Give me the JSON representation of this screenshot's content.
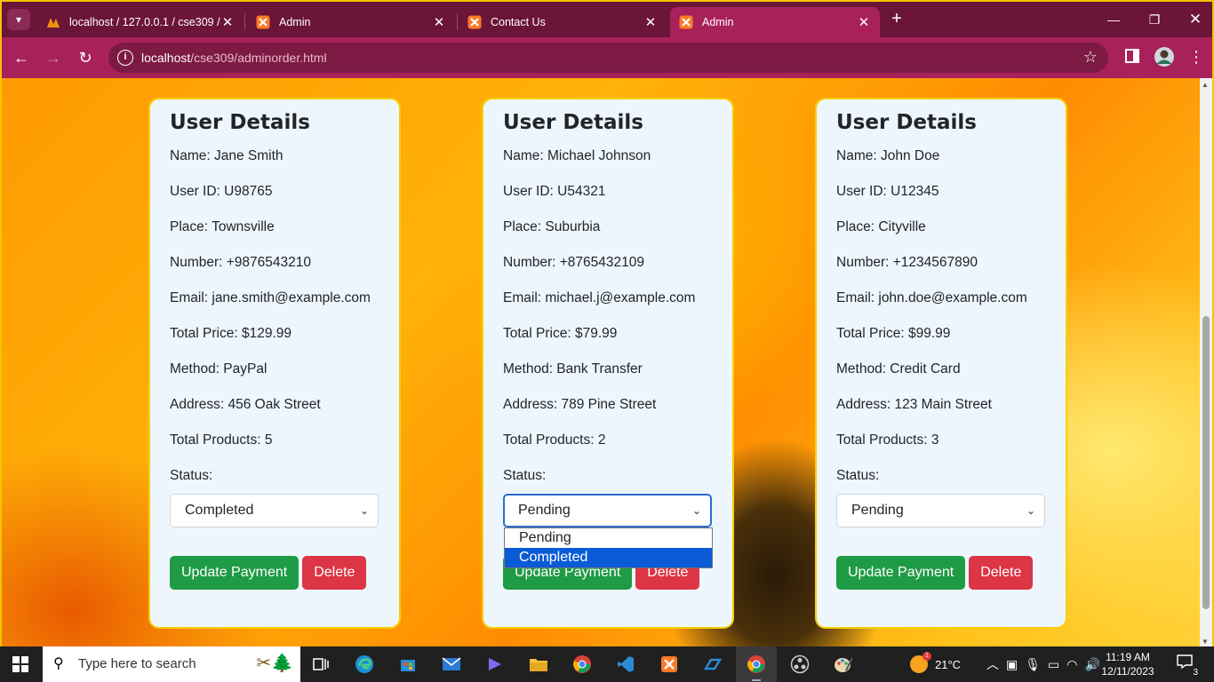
{
  "browser": {
    "tabs": [
      {
        "title": "localhost / 127.0.0.1 / cse309 / u",
        "icon": "phpmyadmin-icon",
        "active": false
      },
      {
        "title": "Admin",
        "icon": "xampp-icon",
        "active": false
      },
      {
        "title": "Contact Us",
        "icon": "xampp-icon",
        "active": false
      },
      {
        "title": "Admin",
        "icon": "xampp-icon",
        "active": true
      }
    ],
    "url_host": "localhost",
    "url_path": "/cse309/adminorder.html",
    "accent": "#a8215a"
  },
  "cards": [
    {
      "title": "User Details",
      "name": "Name: Jane Smith",
      "user_id": "User ID: U98765",
      "place": "Place: Townsville",
      "number": "Number: +9876543210",
      "email": "Email: jane.smith@example.com",
      "total_price": "Total Price: $129.99",
      "method": "Method: PayPal",
      "address": "Address: 456 Oak Street",
      "total_products": "Total Products: 5",
      "status_label": "Status:",
      "status_value": "Completed",
      "update_label": "Update Payment",
      "delete_label": "Delete"
    },
    {
      "title": "User Details",
      "name": "Name: Michael Johnson",
      "user_id": "User ID: U54321",
      "place": "Place: Suburbia",
      "number": "Number: +8765432109",
      "email": "Email: michael.j@example.com",
      "total_price": "Total Price: $79.99",
      "method": "Method: Bank Transfer",
      "address": "Address: 789 Pine Street",
      "total_products": "Total Products: 2",
      "status_label": "Status:",
      "status_value": "Pending",
      "update_label": "Update Payment",
      "delete_label": "Delete"
    },
    {
      "title": "User Details",
      "name": "Name: John Doe",
      "user_id": "User ID: U12345",
      "place": "Place: Cityville",
      "number": "Number: +1234567890",
      "email": "Email: john.doe@example.com",
      "total_price": "Total Price: $99.99",
      "method": "Method: Credit Card",
      "address": "Address: 123 Main Street",
      "total_products": "Total Products: 3",
      "status_label": "Status:",
      "status_value": "Pending",
      "update_label": "Update Payment",
      "delete_label": "Delete"
    }
  ],
  "dropdown": {
    "options": [
      "Pending",
      "Completed"
    ],
    "highlighted": "Completed"
  },
  "taskbar": {
    "search_placeholder": "Type here to search",
    "weather": "21°C",
    "time": "11:19 AM",
    "date": "12/11/2023",
    "notification_count": "3"
  }
}
